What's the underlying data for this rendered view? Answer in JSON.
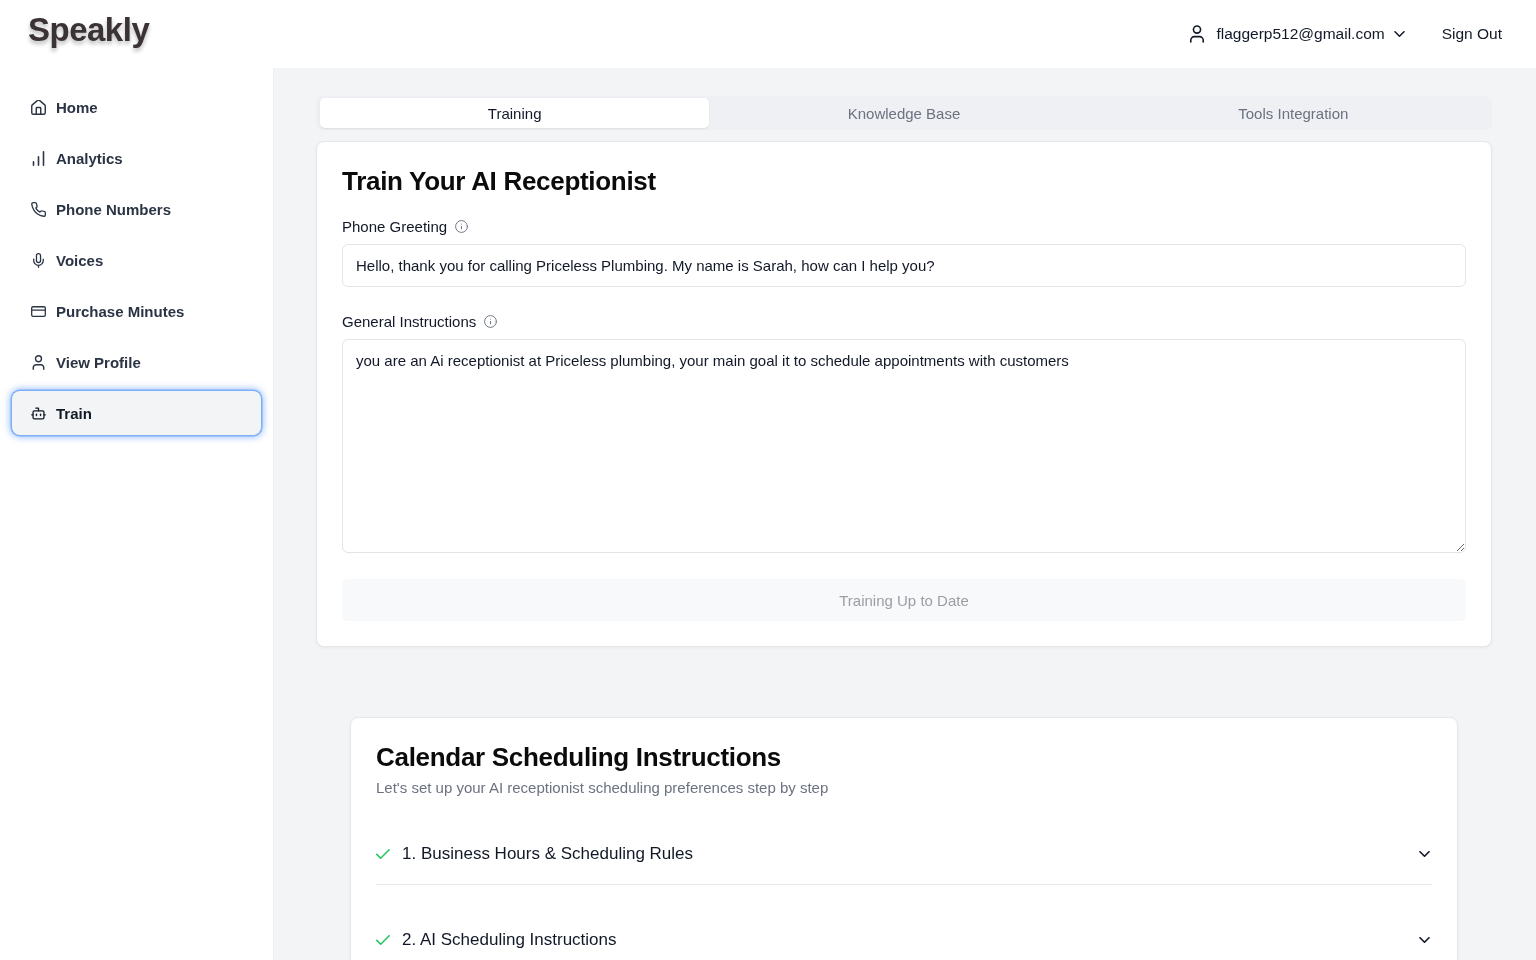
{
  "header": {
    "logo": "Speakly",
    "account": {
      "email": "flaggerp512@gmail.com",
      "expanded": false
    },
    "sign_out": "Sign Out"
  },
  "sidebar": {
    "items": [
      {
        "label": "Home",
        "selected": false
      },
      {
        "label": "Analytics",
        "selected": false
      },
      {
        "label": "Phone Numbers",
        "selected": false
      },
      {
        "label": "Voices",
        "selected": false
      },
      {
        "label": "Purchase Minutes",
        "selected": false
      },
      {
        "label": "View Profile",
        "selected": false
      },
      {
        "label": "Train",
        "selected": true
      }
    ]
  },
  "tabs": [
    {
      "label": "Training",
      "selected": true
    },
    {
      "label": "Knowledge Base",
      "selected": false
    },
    {
      "label": "Tools Integration",
      "selected": false
    }
  ],
  "training": {
    "title": "Train Your AI Receptionist",
    "fields": [
      {
        "kind": "input",
        "label": "Phone Greeting",
        "value": "Hello, thank you for calling Priceless Plumbing. My name is Sarah, how can I help you?"
      },
      {
        "kind": "textarea",
        "label": "General Instructions",
        "value": "you are an Ai receptionist at Priceless plumbing, your main goal it to schedule appointments with customers"
      }
    ],
    "submit": {
      "label": "Training Up to Date",
      "disabled": true
    }
  },
  "scheduling": {
    "title": "Calendar Scheduling Instructions",
    "subtitle": "Let's set up your AI receptionist scheduling preferences step by step",
    "steps": [
      {
        "label": "1. Business Hours & Scheduling Rules",
        "complete": true,
        "expanded": false
      },
      {
        "label": "2. AI Scheduling Instructions",
        "complete": true,
        "expanded": false
      }
    ]
  }
}
